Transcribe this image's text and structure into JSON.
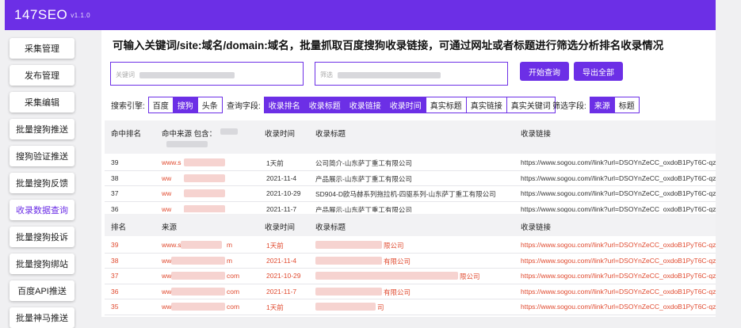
{
  "app": {
    "name": "147SEO",
    "version": "v1.1.0"
  },
  "sidebar": {
    "items": [
      {
        "label": "采集管理",
        "active": false
      },
      {
        "label": "发布管理",
        "active": false
      },
      {
        "label": "采集编辑",
        "active": false
      },
      {
        "label": "批量搜狗推送",
        "active": false
      },
      {
        "label": "搜狗验证推送",
        "active": false
      },
      {
        "label": "批量搜狗反馈",
        "active": false
      },
      {
        "label": "收录数据查询",
        "active": true
      },
      {
        "label": "批量搜狗投诉",
        "active": false
      },
      {
        "label": "批量搜狗绑站",
        "active": false
      },
      {
        "label": "百度API推送",
        "active": false
      },
      {
        "label": "批量神马推送",
        "active": false
      }
    ]
  },
  "main": {
    "title": "可输入关键词/site:域名/domain:域名，批量抓取百度搜狗收录链接，可通过网址或者标题进行筛选分析排名收录情况",
    "keyword_input": {
      "placeholder": "关键词"
    },
    "filter_input": {
      "placeholder": "筛选"
    },
    "buttons": {
      "query": "开始查询",
      "export": "导出全部"
    },
    "filters": {
      "engine_label": "搜索引擎:",
      "engines": [
        {
          "label": "百度",
          "on": false
        },
        {
          "label": "搜狗",
          "on": true
        },
        {
          "label": "头条",
          "on": false
        }
      ],
      "fields_label": "查询字段:",
      "fields": [
        {
          "label": "收录排名",
          "on": true
        },
        {
          "label": "收录标题",
          "on": true
        },
        {
          "label": "收录链接",
          "on": true
        },
        {
          "label": "收录时间",
          "on": true
        },
        {
          "label": "真实标题",
          "on": false
        },
        {
          "label": "真实链接",
          "on": false
        },
        {
          "label": "真实关键词",
          "on": false
        }
      ],
      "screen_label": "筛选字段:",
      "screen": [
        {
          "label": "来源",
          "on": true
        },
        {
          "label": "标题",
          "on": false
        }
      ]
    },
    "table1": {
      "headers": [
        "命中排名",
        "命中来源 包含：",
        "收录时间",
        "收录标题",
        "收录链接"
      ],
      "rows": [
        {
          "rank": "39",
          "source": "www.s",
          "time": "1天前",
          "title": "公司简介-山东萨丁重工有限公司",
          "link": "https://www.sogou.com//link?url=DSOYnZeCC_oxdoB1PyT6C-qz7..."
        },
        {
          "rank": "38",
          "source": "ww",
          "time": "2021-11-4",
          "title": "产品展示-山东萨丁重工有限公司",
          "link": "https://www.sogou.com//link?url=DSOYnZeCC_oxdoB1PyT6C-qz7..."
        },
        {
          "rank": "37",
          "source": "ww",
          "time": "2021-10-29",
          "title": "SD904-D欧马赫系列拖拉机-四驱系列-山东萨丁重工有限公司",
          "link": "https://www.sogou.com//link?url=DSOYnZeCC_oxdoB1PyT6C-qz7..."
        },
        {
          "rank": "36",
          "source": "ww",
          "time": "2021-11-7",
          "title": "产品展示-山东萨丁重工有限公司",
          "link": "https://www.sogou.com//link?url=DSOYnZeCC_oxdoB1PyT6C-qz7..."
        }
      ]
    },
    "table2": {
      "headers": [
        "排名",
        "来源",
        "收录时间",
        "收录标题",
        "收录链接"
      ],
      "rows": [
        {
          "rank": "39",
          "source": "www.s",
          "source_tail": "m",
          "time": "1天前",
          "title_tail": "限公司",
          "link": "https://www.sogou.com//link?url=DSOYnZeCC_oxdoB1PyT6C-qz7..."
        },
        {
          "rank": "38",
          "source": "ww",
          "source_tail": "m",
          "time": "2021-11-4",
          "title_tail": "有限公司",
          "link": "https://www.sogou.com//link?url=DSOYnZeCC_oxdoB1PyT6C-qz7..."
        },
        {
          "rank": "37",
          "source": "ww",
          "source_tail": "com",
          "time": "2021-10-29",
          "title_tail": "限公司",
          "link": "https://www.sogou.com//link?url=DSOYnZeCC_oxdoB1PyT6C-qz7..."
        },
        {
          "rank": "36",
          "source": "ww",
          "source_tail": "com",
          "time": "2021-11-7",
          "title_tail": "有限公司",
          "link": "https://www.sogou.com//link?url=DSOYnZeCC_oxdoB1PyT6C-qz7..."
        },
        {
          "rank": "35",
          "source": "ww",
          "source_tail": "com",
          "time": "1天前",
          "title_tail": "司",
          "link": "https://www.sogou.com//link?url=DSOYnZeCC_oxdoB1PyT6C-qz7..."
        }
      ]
    }
  },
  "colors": {
    "accent": "#6c2fe6",
    "highlight_text": "#e04a2f"
  }
}
